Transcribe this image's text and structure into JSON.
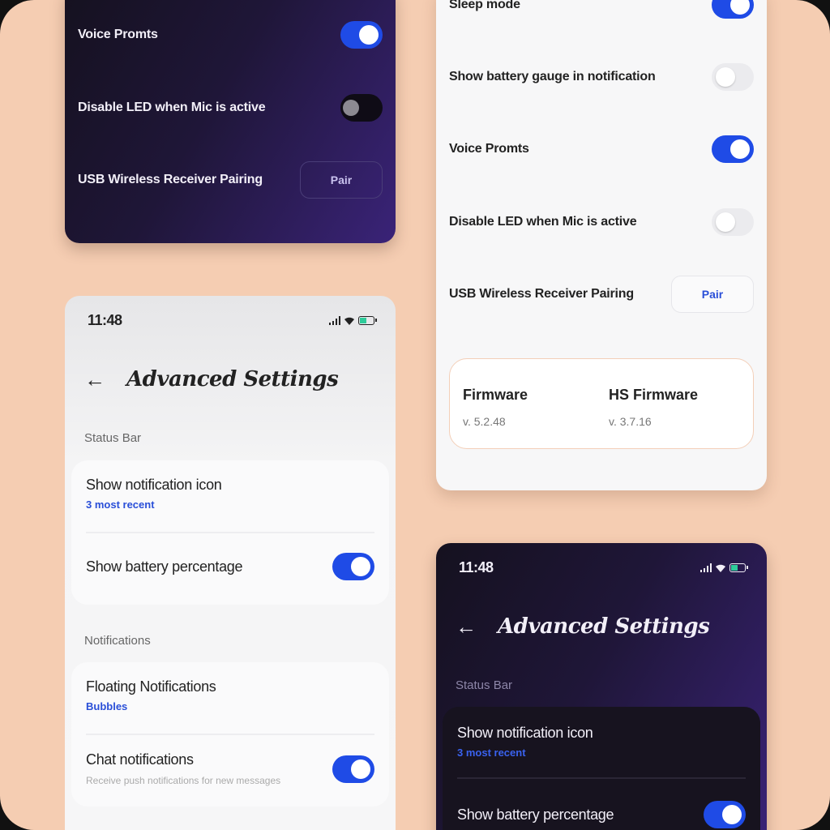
{
  "colors": {
    "background": "#f5cdb2",
    "accent": "#1f4be6",
    "dark_bg": "#1f1638"
  },
  "card1": {
    "rows": [
      {
        "label": "Voice Promts",
        "control": "toggle",
        "state": "on"
      },
      {
        "label": "Disable LED when Mic is active",
        "control": "toggle",
        "state": "off"
      },
      {
        "label": "USB Wireless Receiver Pairing",
        "control": "button",
        "button_label": "Pair"
      }
    ]
  },
  "card2": {
    "rows": [
      {
        "label": "Sleep mode",
        "control": "toggle",
        "state": "on"
      },
      {
        "label": "Show battery gauge in notification",
        "control": "toggle",
        "state": "off"
      },
      {
        "label": "Voice Promts",
        "control": "toggle",
        "state": "on"
      },
      {
        "label": "Disable LED when Mic is active",
        "control": "toggle",
        "state": "off"
      },
      {
        "label": "USB Wireless Receiver Pairing",
        "control": "button",
        "button_label": "Pair"
      }
    ],
    "firmware": {
      "label": "Firmware",
      "version": "v. 5.2.48"
    },
    "hs_firmware": {
      "label": "HS Firmware",
      "version": "v. 3.7.16"
    }
  },
  "card3": {
    "time": "11:48",
    "title": "Advanced Settings",
    "sections": {
      "status_bar": {
        "heading": "Status Bar",
        "notification_icon": {
          "title": "Show notification icon",
          "subtitle": "3 most recent"
        },
        "battery_percentage": {
          "title": "Show battery percentage",
          "state": "on"
        }
      },
      "notifications": {
        "heading": "Notifications",
        "floating": {
          "title": "Floating Notifications",
          "subtitle": "Bubbles"
        },
        "chat": {
          "title": "Chat notifications",
          "description": "Receive push notifications for new messages",
          "state": "on"
        }
      }
    }
  },
  "card4": {
    "time": "11:48",
    "title": "Advanced Settings",
    "section_heading": "Status Bar",
    "notification_icon": {
      "title": "Show notification icon",
      "subtitle": "3 most recent"
    },
    "battery_percentage": {
      "title": "Show battery percentage",
      "state": "on"
    }
  },
  "icons": [
    "back-arrow-icon",
    "signal-icon",
    "wifi-icon",
    "battery-icon"
  ]
}
